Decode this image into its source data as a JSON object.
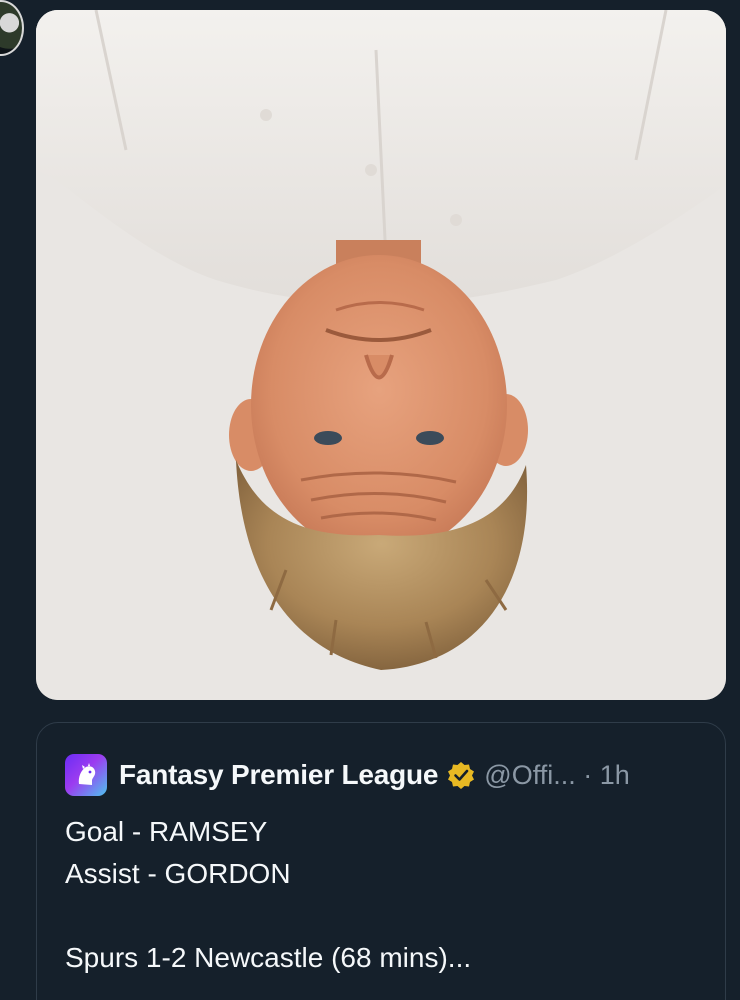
{
  "quote": {
    "account_name": "Fantasy Premier League",
    "handle_time": "@Offi... · 1h",
    "lines": [
      "Goal - RAMSEY",
      "Assist - GORDON",
      "",
      "Spurs 1-2 Newcastle (68 mins)..."
    ]
  },
  "icons": {
    "logo": "premier-league-lion-icon",
    "verified": "gold-verified-badge-icon"
  },
  "colors": {
    "background": "#15202b",
    "card_border": "#2f3c49",
    "text_primary": "#f5f8fa",
    "text_secondary": "#8b98a5",
    "verified": "#e8b923"
  }
}
